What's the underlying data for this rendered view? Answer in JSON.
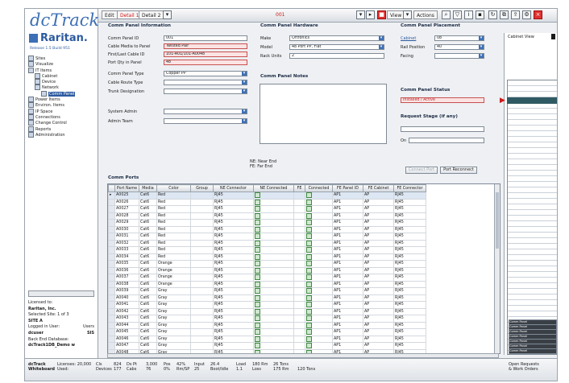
{
  "app": {
    "logo": "dcTrack",
    "brand": "Raritan.",
    "version": "Release 1.5 Build 951"
  },
  "toolbar": {
    "edit": "Edit",
    "detail1": "Detail 1",
    "detail2": "Detail 2",
    "item_number": "001",
    "view": "View",
    "actions": "Actions"
  },
  "tree": [
    {
      "label": "Sites",
      "indent": 0,
      "selected": false
    },
    {
      "label": "Visualize",
      "indent": 0,
      "selected": false
    },
    {
      "label": "IT Items",
      "indent": 0,
      "selected": false
    },
    {
      "label": "Cabinet",
      "indent": 1,
      "selected": false
    },
    {
      "label": "Device",
      "indent": 1,
      "selected": false
    },
    {
      "label": "Network",
      "indent": 1,
      "selected": false
    },
    {
      "label": "Comm Panel",
      "indent": 2,
      "selected": true
    },
    {
      "label": "Power Items",
      "indent": 0,
      "selected": false
    },
    {
      "label": "Environ. Items",
      "indent": 0,
      "selected": false
    },
    {
      "label": "IP Space",
      "indent": 0,
      "selected": false
    },
    {
      "label": "Connections",
      "indent": 0,
      "selected": false
    },
    {
      "label": "Change Control",
      "indent": 0,
      "selected": false
    },
    {
      "label": "Reports",
      "indent": 0,
      "selected": false
    },
    {
      "label": "Administration",
      "indent": 0,
      "selected": false
    }
  ],
  "info": {
    "licensed_to": "Licensed to:",
    "company": "Raritan, Inc.",
    "selected_site": "Selected Site:",
    "site_count": "1 of 3",
    "site": "SITE A",
    "logged_in_as": "Logged in User:",
    "role": "Users",
    "user": "dcuser",
    "user_extra": "SIS",
    "database_label": "Back End Database:",
    "database": "dcTrack1DB_Demo w"
  },
  "sections": {
    "info": "Comm Panel Information",
    "hardware": "Comm Panel Hardware",
    "placement": "Comm Panel Placement",
    "notes": "Comm Panel Notes",
    "status": "Comm Panel Status",
    "request": "Request Stage (if any)",
    "ports": "Comm Ports"
  },
  "fields": {
    "panel_id_label": "Comm Panel ID",
    "panel_id": "001",
    "cable_media_label": "Cable Media to Panel",
    "cable_media": "Twisted Pair",
    "first_last_label": "First/Last Cable ID",
    "first_last": "101-A01/101-A0048",
    "port_qty_label": "Port Qty in Panel",
    "port_qty": "48",
    "panel_type_label": "Comm Panel Type",
    "panel_type": "Copper PP",
    "cable_route_label": "Cable Route Type",
    "cable_route": "",
    "trunk_label": "Trunk Designation",
    "trunk": "",
    "system_admin_label": "System Admin",
    "system_admin": "",
    "admin_team_label": "Admin Team",
    "admin_team": "",
    "make_label": "Make",
    "make": "Ortronics",
    "model_label": "Model",
    "model": "48 Port PP, Flat",
    "rack_units_label": "Rack Units",
    "rack_units": "2",
    "cabinet_label": "Cabinet",
    "cabinet": "08",
    "rail_position_label": "Rail Position",
    "rail_position": "40",
    "facing_label": "Facing",
    "facing": "",
    "status": "Installed / Active",
    "request_stage": "",
    "on_label": "On",
    "on": ""
  },
  "legend": {
    "ne": "NE: Near End",
    "fe": "FE: Far End"
  },
  "buttons": {
    "connect": "Connect Port",
    "reconnect": "Port Reconnect"
  },
  "grid": {
    "headers": [
      "",
      "Port Name",
      "Media",
      "Color",
      "Group",
      "NE Connector",
      "NE Connected",
      "FE",
      "Connected",
      "FE Panel ID",
      "FE Cabinet",
      "FE Connector"
    ],
    "rows": [
      [
        "A0025",
        "Cat6",
        "Red",
        "RJ45",
        "AP1",
        "AP",
        "RJ45"
      ],
      [
        "A0026",
        "Cat6",
        "Red",
        "RJ45",
        "AP1",
        "AP",
        "RJ45"
      ],
      [
        "A0027",
        "Cat6",
        "Red",
        "RJ45",
        "AP1",
        "AP",
        "RJ45"
      ],
      [
        "A0028",
        "Cat6",
        "Red",
        "RJ45",
        "AP1",
        "AP",
        "RJ45"
      ],
      [
        "A0029",
        "Cat6",
        "Red",
        "RJ45",
        "AP1",
        "AP",
        "RJ45"
      ],
      [
        "A0030",
        "Cat6",
        "Red",
        "RJ45",
        "AP1",
        "AP",
        "RJ45"
      ],
      [
        "A0031",
        "Cat6",
        "Red",
        "RJ45",
        "AP1",
        "AP",
        "RJ45"
      ],
      [
        "A0032",
        "Cat6",
        "Red",
        "RJ45",
        "AP1",
        "AP",
        "RJ45"
      ],
      [
        "A0033",
        "Cat6",
        "Red",
        "RJ45",
        "AP1",
        "AP",
        "RJ45"
      ],
      [
        "A0034",
        "Cat6",
        "Red",
        "RJ45",
        "AP1",
        "AP",
        "RJ45"
      ],
      [
        "A0035",
        "Cat6",
        "Orange",
        "RJ45",
        "AP1",
        "AP",
        "RJ45"
      ],
      [
        "A0036",
        "Cat6",
        "Orange",
        "RJ45",
        "AP1",
        "AP",
        "RJ45"
      ],
      [
        "A0037",
        "Cat6",
        "Orange",
        "RJ45",
        "AP1",
        "AP",
        "RJ45"
      ],
      [
        "A0038",
        "Cat6",
        "Orange",
        "RJ45",
        "AP1",
        "AP",
        "RJ45"
      ],
      [
        "A0039",
        "Cat6",
        "Gray",
        "RJ45",
        "AP1",
        "AP",
        "RJ45"
      ],
      [
        "A0040",
        "Cat6",
        "Gray",
        "RJ45",
        "AP1",
        "AP",
        "RJ45"
      ],
      [
        "A0041",
        "Cat6",
        "Gray",
        "RJ45",
        "AP1",
        "AP",
        "RJ45"
      ],
      [
        "A0042",
        "Cat6",
        "Gray",
        "RJ45",
        "AP1",
        "AP",
        "RJ45"
      ],
      [
        "A0043",
        "Cat6",
        "Gray",
        "RJ45",
        "AP1",
        "AP",
        "RJ45"
      ],
      [
        "A0044",
        "Cat6",
        "Gray",
        "RJ45",
        "AP1",
        "AP",
        "RJ45"
      ],
      [
        "A0045",
        "Cat6",
        "Gray",
        "RJ45",
        "AP1",
        "AP",
        "RJ45"
      ],
      [
        "A0046",
        "Cat6",
        "Gray",
        "RJ45",
        "AP1",
        "AP",
        "RJ45"
      ],
      [
        "A0047",
        "Cat6",
        "Gray",
        "RJ45",
        "AP1",
        "AP",
        "RJ45"
      ],
      [
        "A0048",
        "Cat6",
        "Gray",
        "RJ45",
        "AP1",
        "AP",
        "RJ45"
      ]
    ]
  },
  "right_panel": {
    "title": "Cabinet View",
    "items": [
      "Comm Panel",
      "Comm Panel",
      "Comm Panel",
      "Comm Panel",
      "Comm Panel",
      "Comm Panel",
      "Comm Panel"
    ]
  },
  "status_bar": {
    "c1a": "dcTrack",
    "c1b": "Whiteboard",
    "c2a": "Licenses: 20,000",
    "c2b": "Used:",
    "c3a": "Cls",
    "c3b": "Devices",
    "c4a": "824",
    "c4b": "177",
    "c5a": "Ds Pt",
    "c5b": "Cabs",
    "c6a": "3,000",
    "c6b": "76",
    "c7a": "Pos",
    "c7b": "0%",
    "c8a": "42%",
    "c8b": "Rm/SP",
    "c9a": "Input",
    "c9b": "25",
    "c10a": "26.4",
    "c10b": "Boot/Idle",
    "c11a": "Load",
    "c11b": "1.1",
    "c12a": "180 Rm",
    "c12b": "Loss",
    "c13a": "26 Tons",
    "c13b": "175 Rm",
    "c14b": "120 Tons",
    "c15a": "Open Requests",
    "c15b": "& Work Orders"
  }
}
